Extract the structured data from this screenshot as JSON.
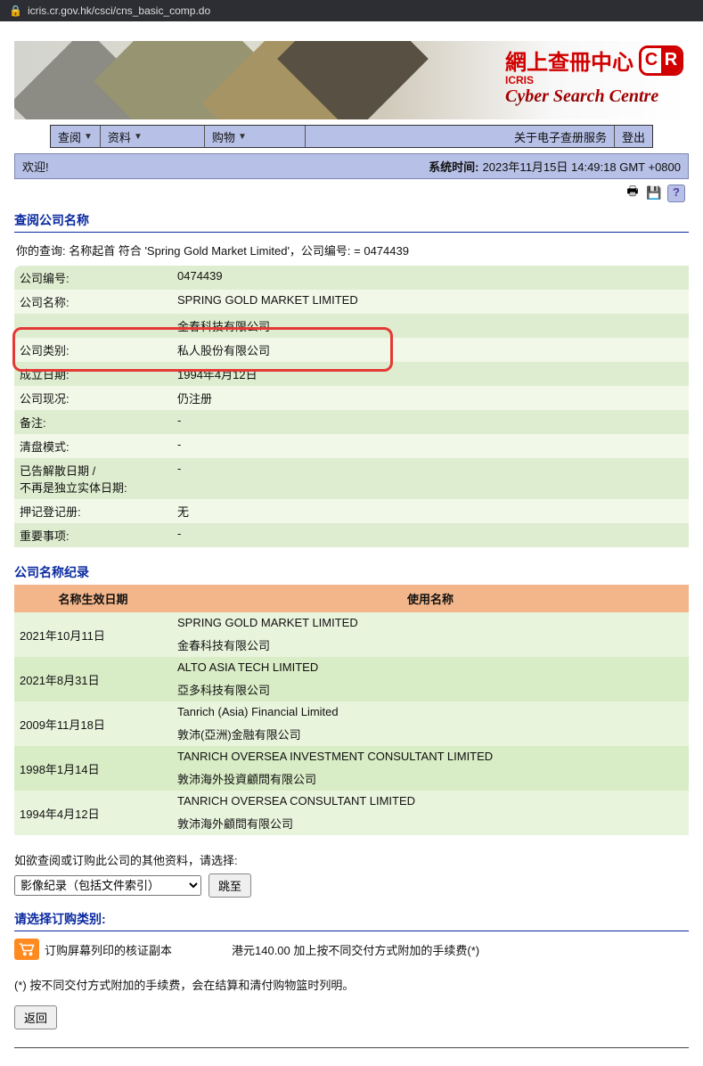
{
  "browser": {
    "url": "icris.cr.gov.hk/csci/cns_basic_comp.do"
  },
  "banner": {
    "cn_title": "網上查冊中心",
    "icris": "ICRIS",
    "tagline": "Cyber Search Centre"
  },
  "menu": {
    "search": "查阅",
    "resources": "资料",
    "cart": "购物",
    "about": "关于电子查册服务",
    "logout": "登出"
  },
  "status": {
    "welcome": "欢迎!",
    "label": "系统时间:",
    "time": "2023年11月15日 14:49:18 GMT +0800"
  },
  "page": {
    "title": "查阅公司名称",
    "query": "你的查询:   名称起首 符合 'Spring Gold Market Limited'，公司编号:   = 0474439"
  },
  "company": {
    "cr_no_label": "公司编号:",
    "cr_no": "0474439",
    "name_label": "公司名称:",
    "name_en": "SPRING GOLD MARKET LIMITED",
    "name_cn": "金春科技有限公司",
    "type_label": "公司类别:",
    "type": "私人股份有限公司",
    "inc_date_label": "成立日期:",
    "inc_date": "1994年4月12日",
    "status_label": "公司现况:",
    "status": "仍注册",
    "remarks_label": "备注:",
    "remarks": "-",
    "winding_label": "清盘模式:",
    "winding": "-",
    "dissolved_label": "已告解散日期 /\n不再是独立实体日期:",
    "dissolved": "-",
    "charges_label": "押记登记册:",
    "charges": "无",
    "events_label": "重要事项:",
    "events": "-"
  },
  "history": {
    "title": "公司名称纪录",
    "col_date": "名称生效日期",
    "col_name": "使用名称",
    "rows": [
      {
        "date": "2021年10月11日",
        "en": "SPRING GOLD MARKET LIMITED",
        "cn": "金春科技有限公司"
      },
      {
        "date": "2021年8月31日",
        "en": "ALTO ASIA TECH LIMITED",
        "cn": "亞多科技有限公司"
      },
      {
        "date": "2009年11月18日",
        "en": "Tanrich (Asia) Financial Limited",
        "cn": "敦沛(亞洲)金融有限公司"
      },
      {
        "date": "1998年1月14日",
        "en": "TANRICH OVERSEA INVESTMENT CONSULTANT LIMITED",
        "cn": "敦沛海外投資顧問有限公司"
      },
      {
        "date": "1994年4月12日",
        "en": "TANRICH OVERSEA CONSULTANT LIMITED",
        "cn": "敦沛海外顧問有限公司"
      }
    ]
  },
  "order": {
    "prompt": "如欲查阅或订购此公司的其他资料，请选择:",
    "select_option": "影像纪录（包括文件索引）",
    "goto": "跳至",
    "category": "请选择订购类别:",
    "item": "订购屏幕列印的核证副本",
    "price": "港元140.00 加上按不同交付方式附加的手续费(*)",
    "footnote": "(*) 按不同交付方式附加的手续费，会在结算和清付购物篮时列明。",
    "back": "返回"
  }
}
